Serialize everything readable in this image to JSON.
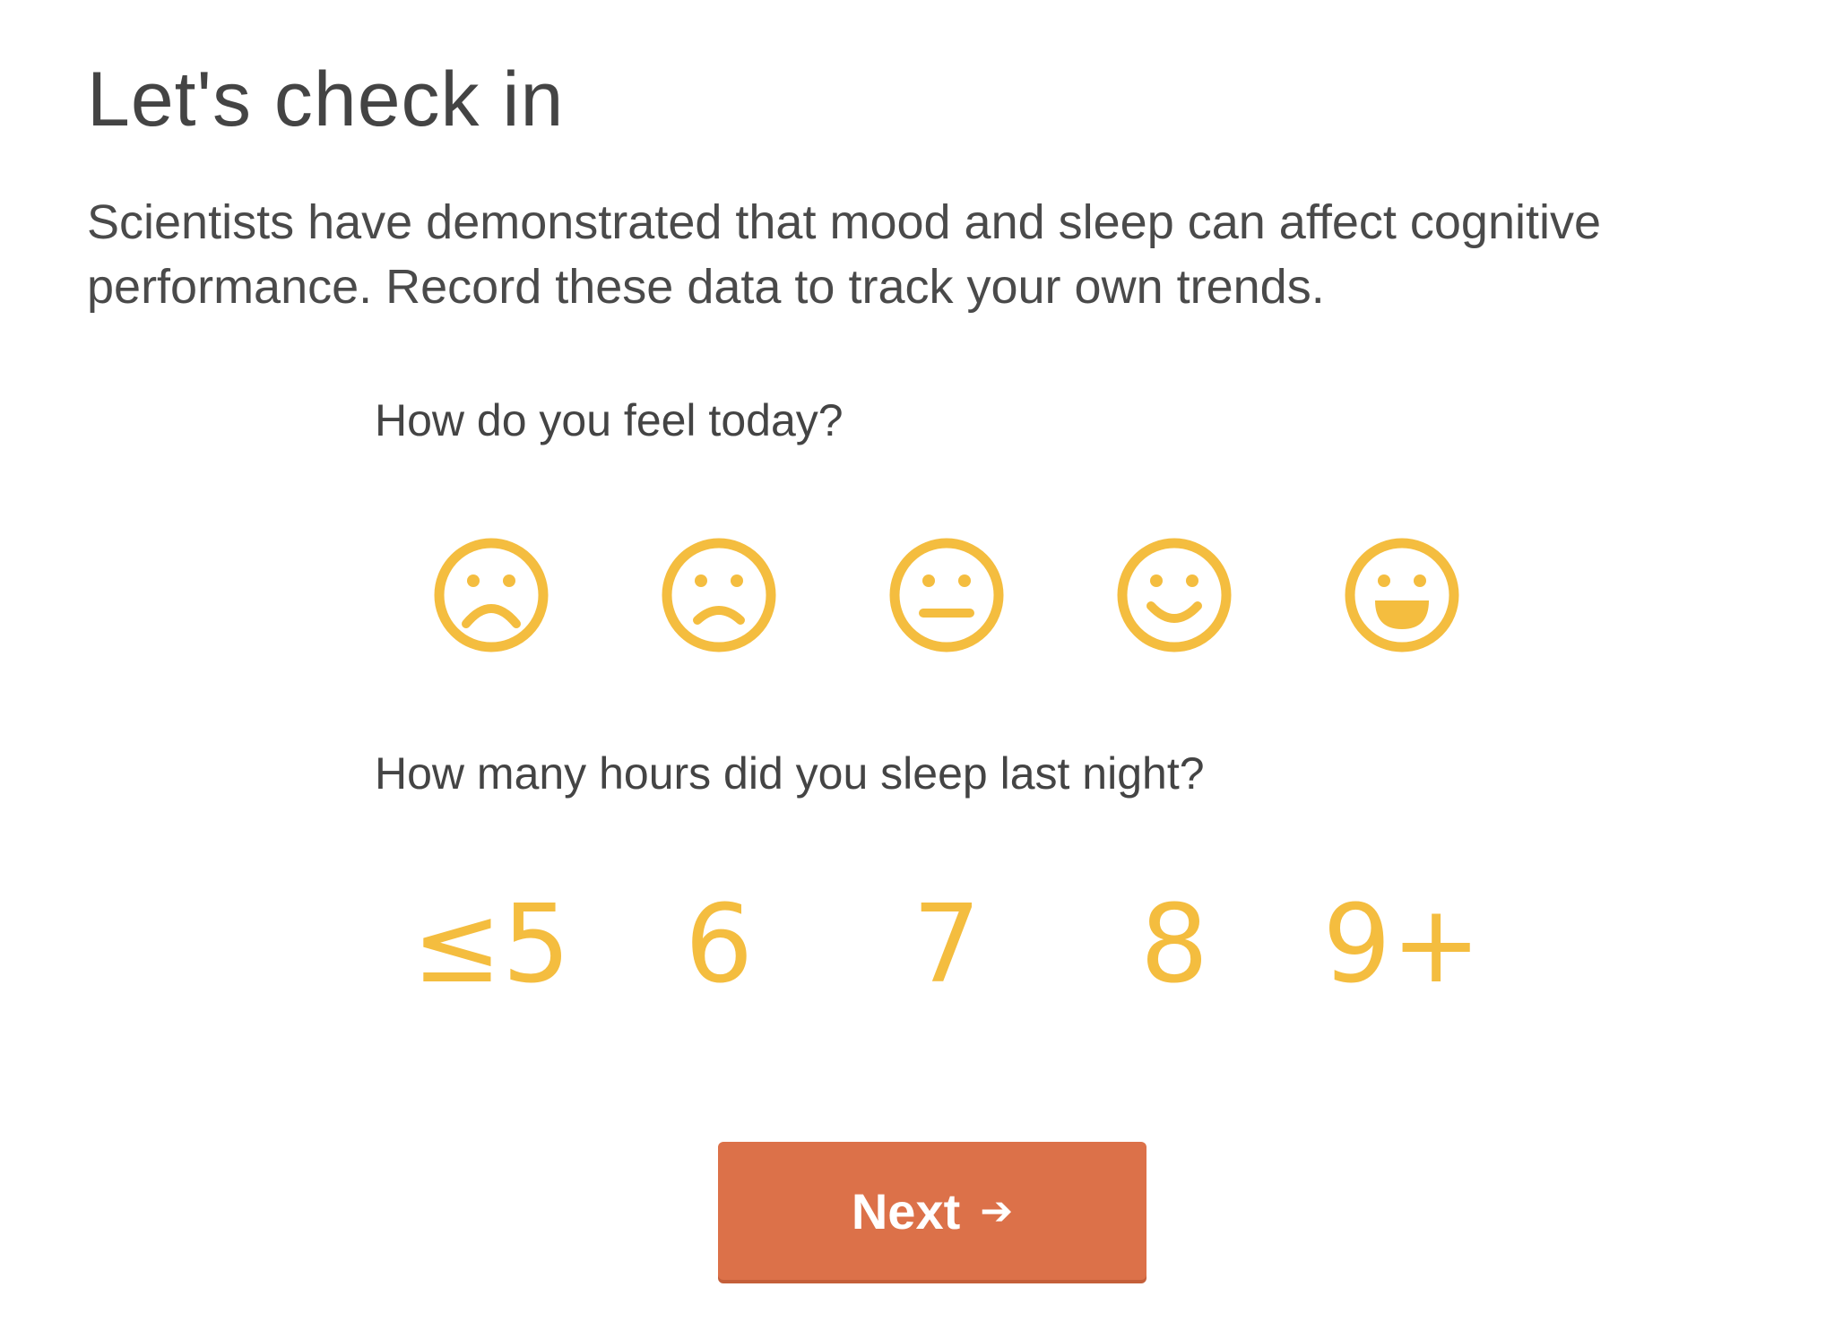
{
  "header": {
    "title": "Let's check in"
  },
  "intro": {
    "text": "Scientists have demonstrated that mood and sleep can affect cognitive performance. Record these data to track your own trends."
  },
  "mood": {
    "question": "How do you feel today?",
    "options": [
      {
        "icon": "very-sad-face-icon"
      },
      {
        "icon": "sad-face-icon"
      },
      {
        "icon": "neutral-face-icon"
      },
      {
        "icon": "smile-face-icon"
      },
      {
        "icon": "grin-face-icon"
      }
    ]
  },
  "sleep": {
    "question": "How many hours did you sleep last night?",
    "options": [
      "≤5",
      "6",
      "7",
      "8",
      "9+"
    ]
  },
  "actions": {
    "next_label": "Next",
    "next_icon": "arrow-right-icon"
  },
  "colors": {
    "accent": "#f4bd3f",
    "button": "#dc7149",
    "text": "#444444"
  }
}
